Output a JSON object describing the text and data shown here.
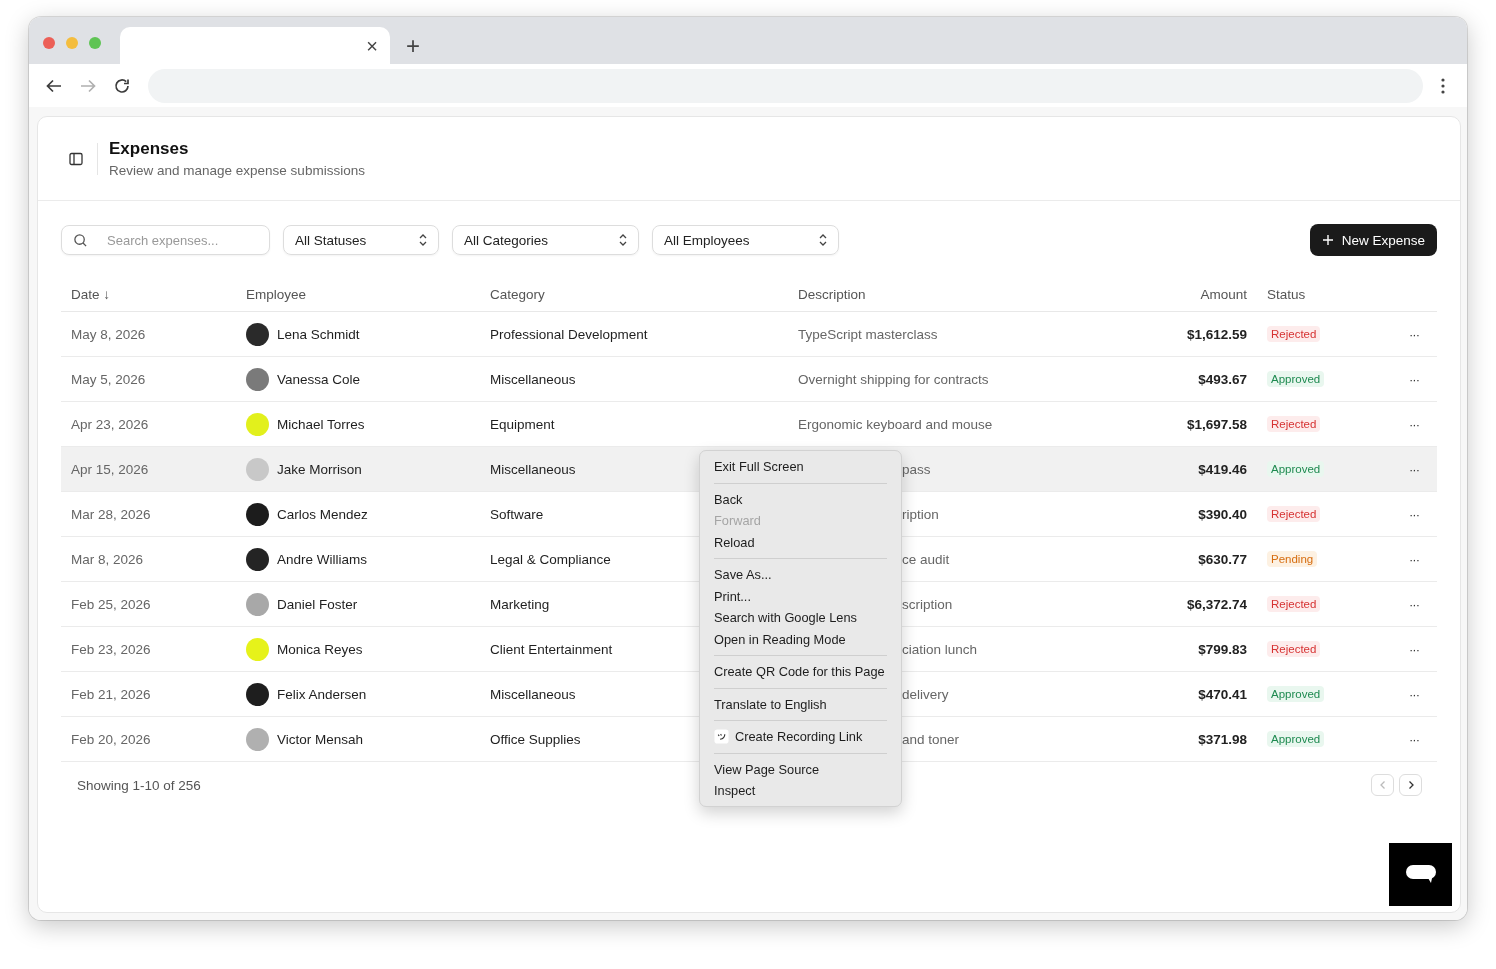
{
  "browser": {
    "tab_close": "×",
    "new_tab": "+"
  },
  "header": {
    "title": "Expenses",
    "subtitle": "Review and manage expense submissions"
  },
  "filters": {
    "search": {
      "placeholder": "Search expenses..."
    },
    "selects": [
      "All Statuses",
      "All Categories",
      "All Employees"
    ],
    "new_button": "New Expense"
  },
  "table": {
    "columns": [
      "Date ↓",
      "Employee",
      "Category",
      "Description",
      "Amount",
      "Status"
    ],
    "rows": [
      {
        "date": "May 8, 2026",
        "employee": "Lena Schmidt",
        "color": "#2a2a2a",
        "category": "Professional Development",
        "description": "TypeScript masterclass",
        "covered": false,
        "amount": "$1,612.59",
        "status": {
          "label": "Rejected",
          "kind": "rejected"
        },
        "actions": "···",
        "hovered": false
      },
      {
        "date": "May 5, 2026",
        "employee": "Vanessa Cole",
        "color": "#7a7a7a",
        "category": "Miscellaneous",
        "description": "Overnight shipping for contracts",
        "covered": false,
        "amount": "$493.67",
        "status": {
          "label": "Approved",
          "kind": "approved"
        },
        "actions": "···",
        "hovered": false
      },
      {
        "date": "Apr 23, 2026",
        "employee": "Michael Torres",
        "color": "#e2f01c",
        "category": "Equipment",
        "description": "Ergonomic keyboard and mouse",
        "covered": false,
        "amount": "$1,697.58",
        "status": {
          "label": "Rejected",
          "kind": "rejected"
        },
        "actions": "···",
        "hovered": false
      },
      {
        "date": "Apr 15, 2026",
        "employee": "Jake Morrison",
        "color": "#c8c8c8",
        "category": "Miscellaneous",
        "description": "pass",
        "covered": true,
        "amount": "$419.46",
        "status": {
          "label": "Approved",
          "kind": "approved"
        },
        "actions": "···",
        "hovered": true
      },
      {
        "date": "Mar 28, 2026",
        "employee": "Carlos Mendez",
        "color": "#1c1c1c",
        "category": "Software",
        "description": "ription",
        "covered": true,
        "amount": "$390.40",
        "status": {
          "label": "Rejected",
          "kind": "rejected"
        },
        "actions": "···",
        "hovered": false
      },
      {
        "date": "Mar 8, 2026",
        "employee": "Andre Williams",
        "color": "#242424",
        "category": "Legal & Compliance",
        "description": "ce audit",
        "covered": true,
        "amount": "$630.77",
        "status": {
          "label": "Pending",
          "kind": "pending"
        },
        "actions": "···",
        "hovered": false
      },
      {
        "date": "Feb 25, 2026",
        "employee": "Daniel Foster",
        "color": "#a8a8a8",
        "category": "Marketing",
        "description": "scription",
        "covered": true,
        "amount": "$6,372.74",
        "status": {
          "label": "Rejected",
          "kind": "rejected"
        },
        "actions": "···",
        "hovered": false
      },
      {
        "date": "Feb 23, 2026",
        "employee": "Monica Reyes",
        "color": "#e6f21a",
        "category": "Client Entertainment",
        "description": "ciation lunch",
        "covered": true,
        "amount": "$799.83",
        "status": {
          "label": "Rejected",
          "kind": "rejected"
        },
        "actions": "···",
        "hovered": false
      },
      {
        "date": "Feb 21, 2026",
        "employee": "Felix Andersen",
        "color": "#1e1e1e",
        "category": "Miscellaneous",
        "description": "delivery",
        "covered": true,
        "amount": "$470.41",
        "status": {
          "label": "Approved",
          "kind": "approved"
        },
        "actions": "···",
        "hovered": false
      },
      {
        "date": "Feb 20, 2026",
        "employee": "Victor Mensah",
        "color": "#b0b0b0",
        "category": "Office Supplies",
        "description": "and toner",
        "covered": true,
        "amount": "$371.98",
        "status": {
          "label": "Approved",
          "kind": "approved"
        },
        "actions": "···",
        "hovered": false
      }
    ]
  },
  "footer": {
    "showing": "Showing 1-10 of 256",
    "prev": {
      "disabled": true
    },
    "next": {
      "disabled": false
    }
  },
  "context_menu": {
    "groups": [
      [
        {
          "label": "Exit Full Screen",
          "kind": "plain",
          "disabled": false
        }
      ],
      [
        {
          "label": "Back",
          "kind": "plain",
          "disabled": false
        },
        {
          "label": "Forward",
          "kind": "plain",
          "disabled": true
        },
        {
          "label": "Reload",
          "kind": "plain",
          "disabled": false
        }
      ],
      [
        {
          "label": "Save As...",
          "kind": "plain",
          "disabled": false
        },
        {
          "label": "Print...",
          "kind": "plain",
          "disabled": false
        },
        {
          "label": "Search with Google Lens",
          "kind": "plain",
          "disabled": false
        },
        {
          "label": "Open in Reading Mode",
          "kind": "plain",
          "disabled": false
        }
      ],
      [
        {
          "label": "Create QR Code for this Page",
          "kind": "plain",
          "disabled": false
        }
      ],
      [
        {
          "label": "Translate to English",
          "kind": "plain",
          "disabled": false
        }
      ],
      [
        {
          "label": "Create Recording Link",
          "kind": "app",
          "disabled": false
        }
      ],
      [
        {
          "label": "View Page Source",
          "kind": "plain",
          "disabled": false
        },
        {
          "label": "Inspect",
          "kind": "plain",
          "disabled": false
        }
      ]
    ]
  }
}
